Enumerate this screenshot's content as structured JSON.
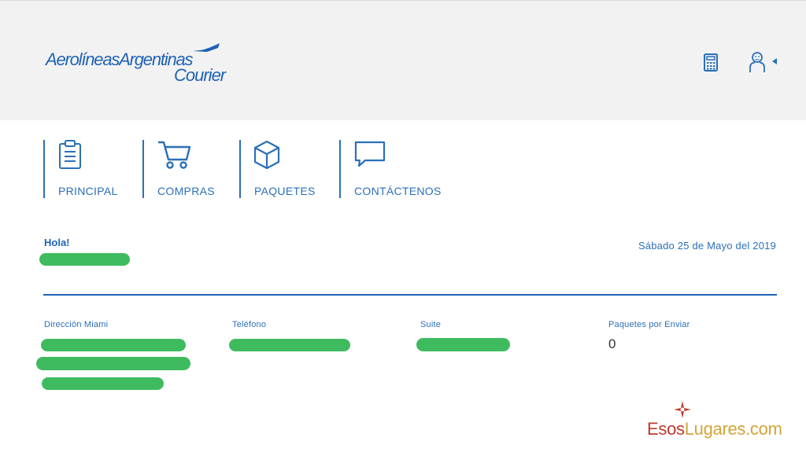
{
  "header": {
    "logo_line1": "AerolíneasArgentinas",
    "logo_line2": "Courier",
    "calculator_icon": "calculator-icon",
    "user_icon": "user-icon",
    "menu_caret_icon": "caret-left-icon"
  },
  "nav": {
    "items": [
      {
        "label": "PRINCIPAL",
        "icon": "clipboard-icon"
      },
      {
        "label": "COMPRAS",
        "icon": "cart-icon"
      },
      {
        "label": "PAQUETES",
        "icon": "box-icon"
      },
      {
        "label": "CONTÁCTENOS",
        "icon": "chat-icon"
      }
    ]
  },
  "welcome": {
    "greeting": "Hola!",
    "date": "Sábado 25 de Mayo del 2019"
  },
  "info": {
    "direccion_label": "Dirección Miami",
    "telefono_label": "Teléfono",
    "suite_label": "Suite",
    "paquetes_label": "Paquetes por Enviar",
    "paquetes_value": "0"
  },
  "watermark": {
    "part1": "Esos",
    "part2": "Lugares.com"
  },
  "colors": {
    "brand_blue": "#1f63b5",
    "link_blue": "#2b6fb8",
    "header_bg": "#f2f2f2",
    "redaction_green": "#3fbb5f"
  }
}
